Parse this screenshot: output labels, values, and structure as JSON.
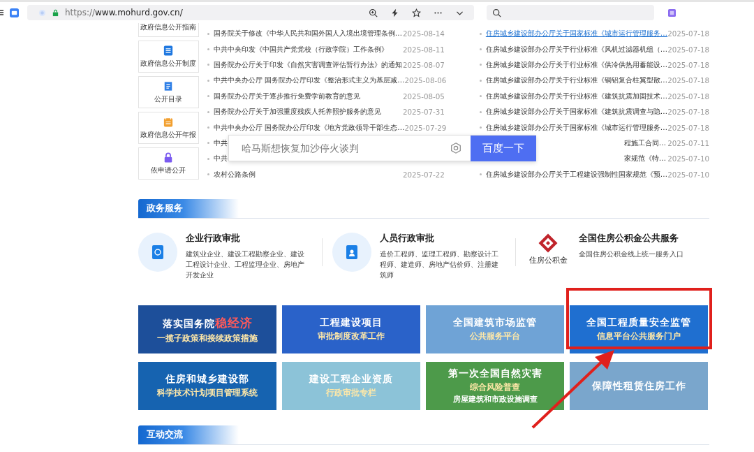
{
  "browser": {
    "url_scheme": "https://",
    "url_host": "www.mohurd.gov.cn/"
  },
  "sidebar": [
    {
      "label": "政府信息公开指南",
      "kind": "cut"
    },
    {
      "label": "政府信息公开制度",
      "kind": "doc"
    },
    {
      "label": "公开目录",
      "kind": "list"
    },
    {
      "label": "政府信息公开年报",
      "kind": "calendar"
    },
    {
      "label": "依申请公开",
      "kind": "lock"
    }
  ],
  "news_left": [
    {
      "title": "国务院关于修改《中华人民共和国外国人入境出境管理条例…",
      "date": "2025-08-14"
    },
    {
      "title": "中共中央印发《中国共产党党校（行政学院）工作条例》",
      "date": "2025-08-11"
    },
    {
      "title": "国务院办公厅关于印发《自然灾害调查评估暂行办法》的通知",
      "date": "2025-08-07"
    },
    {
      "title": "中共中央办公厅 国务院办公厅印发《整治形式主义为基层减…",
      "date": "2025-08-06"
    },
    {
      "title": "国务院办公厅关于逐步推行免费学前教育的意见",
      "date": "2025-08-05"
    },
    {
      "title": "国务院办公厅关于加强重度残疾人托养照护服务的意见",
      "date": "2025-07-31"
    },
    {
      "title": "中共中央办公厅 国务院办公厅印发《地方党政领导干部生态…",
      "date": "2025-07-29"
    },
    {
      "title": "中共"
    },
    {
      "title": "中共"
    },
    {
      "title": "农村公路条例",
      "date": "2025-07-22"
    }
  ],
  "news_right": [
    {
      "title": "住房城乡建设部办公厅关于国家标准《城市运行管理服务…",
      "date": "2025-07-18",
      "hovered": true
    },
    {
      "title": "住房城乡建设部办公厅关于行业标准《风机过滤器机组（…",
      "date": "2025-07-18",
      "hovered": false
    },
    {
      "title": "住房城乡建设部办公厅关于行业标准《供冷供热用蓄能设…",
      "date": "2025-07-18",
      "hovered": false
    },
    {
      "title": "住房城乡建设部办公厅关于行业标准《铜铝复合柱翼型散…",
      "date": "2025-07-18",
      "hovered": false
    },
    {
      "title": "住房城乡建设部办公厅关于行业标准《建筑抗震加固技术…",
      "date": "2025-07-18",
      "hovered": false
    },
    {
      "title": "住房城乡建设部办公厅关于国家标准《建筑抗震调查与隐…",
      "date": "2025-07-18",
      "hovered": false
    },
    {
      "title": "住房城乡建设部办公厅关于国家标准《城市运行管理服务…",
      "date": "2025-07-18",
      "hovered": false
    },
    {
      "title": "程施工合同…",
      "date": "2025-07-11",
      "hovered": false
    },
    {
      "title": "家规范《特…",
      "date": "2025-07-10",
      "hovered": false
    },
    {
      "title": "住房城乡建设部办公厅关于工程建设强制性国家规范《预…",
      "date": "2025-07-10",
      "hovered": false
    }
  ],
  "search_popup": {
    "placeholder": "哈马斯想恢复加沙停火谈判",
    "button": "百度一下"
  },
  "gov_services": {
    "heading": "政务服务",
    "items": [
      {
        "title": "企业行政审批",
        "desc": "建筑业企业、建设工程勘察企业、建设工程设计企业、工程监理企业、房地产开发企业",
        "kind": "doc"
      },
      {
        "title": "人员行政审批",
        "desc": "造价工程师、监理工程师、勘察设计工程师、建造师、房地产估价师、注册建筑师",
        "kind": "badge"
      },
      {
        "title": "全国住房公积金公共服务",
        "desc": "全国住房公积金线上统一服务入口",
        "kind": "logo",
        "logo_text": "住房公积金"
      }
    ]
  },
  "banners": [
    {
      "line1": "落实国务院",
      "highlight": "稳经济",
      "line2": "一揽子政策和接续政策措施",
      "color": "#1d4f9a"
    },
    {
      "line1": "工程建设项目",
      "line2": "审批制度改革工作",
      "color": "#2a62c9"
    },
    {
      "line1": "全国建筑市场监管",
      "line2": "公共服务平台",
      "color": "#6fa3d6"
    },
    {
      "line1": "全国工程质量安全监管",
      "line2": "信息平台公共服务门户",
      "color": "#1f6fd0"
    },
    {
      "line1": "住房和城乡建设部",
      "line2": "科学技术计划项目管理系统",
      "color": "#1663b0"
    },
    {
      "line1": "建设工程企业资质",
      "line2": "行政审批专栏",
      "color": "#8cc3d8"
    },
    {
      "line1": "第一次全国自然灾害",
      "line2": "综合风险普查",
      "line3": "房屋建筑和市政设施调查",
      "color": "#4d9a4a"
    },
    {
      "line1": "保障性租赁住房工作",
      "color": "#7aa6cc"
    }
  ],
  "interaction": {
    "heading": "互动交流"
  }
}
